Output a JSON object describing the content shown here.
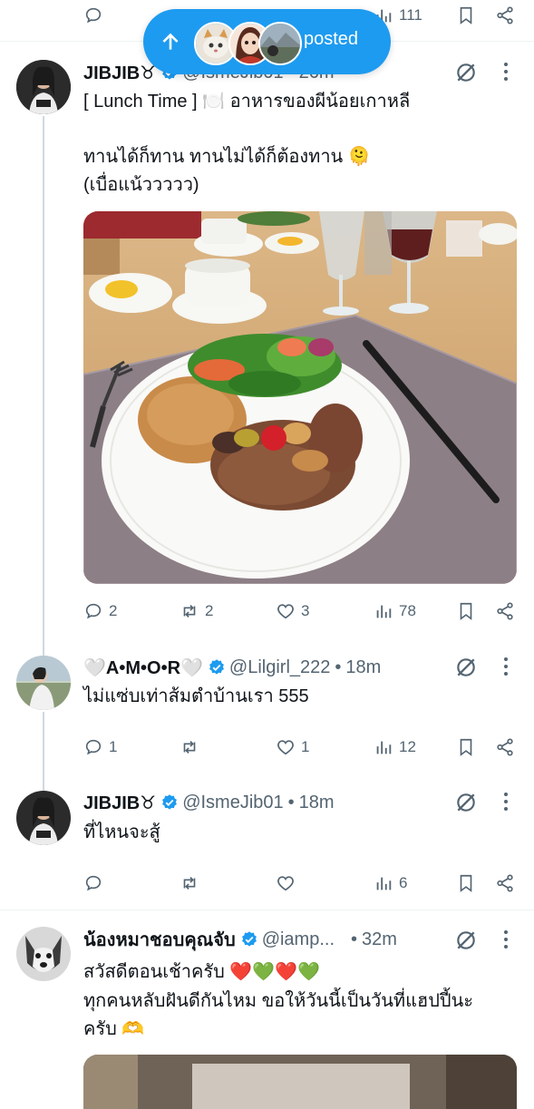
{
  "banner": {
    "label": "posted",
    "icon": "arrow-up-icon",
    "avatars": [
      "cat-avatar",
      "anime-avatar",
      "landscape-avatar"
    ],
    "bg": "#1d9bf0"
  },
  "top_partial": {
    "views": "111"
  },
  "tweets": [
    {
      "name": "JIBJIB♉",
      "handle": "@IsmeJib01",
      "time": "26m",
      "line1": "[ Lunch Time ] 🍽️ อาหารของผีน้อยเกาหลี",
      "line2": "ทานได้ก็ทาน ทานไม่ได้ก็ต้องทาน 🫠",
      "line3": "(เบื่อแน้ววววว)",
      "replies": "2",
      "reposts": "2",
      "likes": "3",
      "views": "78"
    },
    {
      "name": "🤍A•M•O•R🤍",
      "handle": "@Lilgirl_222",
      "time": "18m",
      "line1": "ไม่แซ่บเท่าส้มตำบ้านเรา 555",
      "replies": "1",
      "reposts": "",
      "likes": "1",
      "views": "12"
    },
    {
      "name": "JIBJIB♉",
      "handle": "@IsmeJib01",
      "time": "18m",
      "line1": "ที่ไหนจะสู้",
      "replies": "",
      "reposts": "",
      "likes": "",
      "views": "6"
    },
    {
      "name": "น้องหมาชอบคุณจับ",
      "handle": "@iamp...",
      "time": "32m",
      "line1": "สวัสดีตอนเช้าครับ ❤️💚❤️💚",
      "line2": "ทุกคนหลับฝันดีกันไหม ขอให้วันนี้เป็นวันที่แฮปปี้นะ",
      "line3": "ครับ 🫶"
    }
  ],
  "separator": "•",
  "colors": {
    "accent": "#1d9bf0",
    "text": "#0f1419",
    "secondary": "#536471",
    "divider": "#eff3f4",
    "thread": "#cfd9de"
  }
}
